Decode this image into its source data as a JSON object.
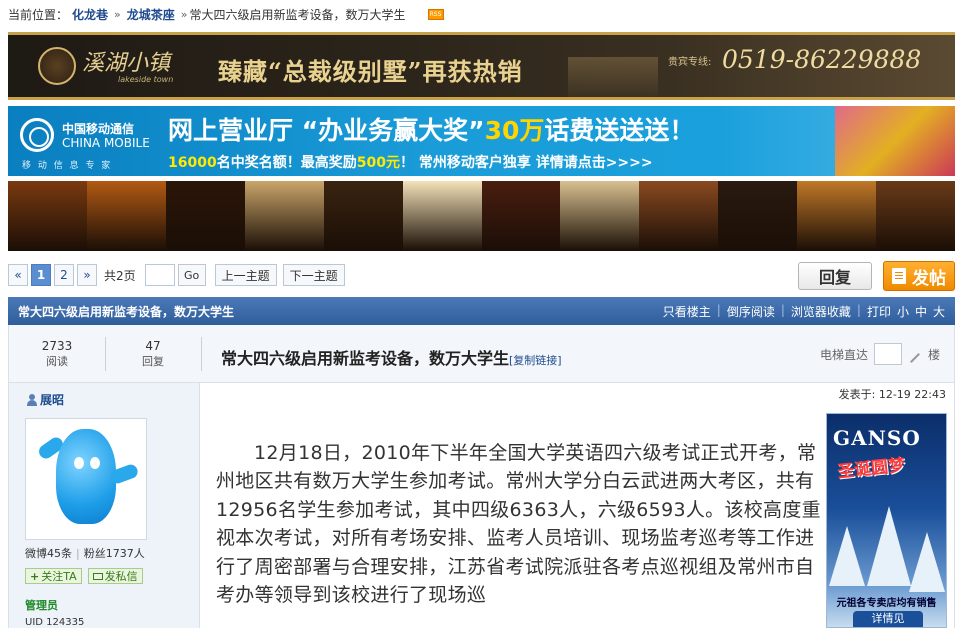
{
  "breadcrumb": {
    "label": "当前位置：",
    "items": [
      "化龙巷",
      "龙城茶座"
    ],
    "separators": [
      "»",
      "»"
    ],
    "current": "常大四六级启用新监考设备，数万大学生",
    "rss_label": "RSS"
  },
  "banners": {
    "realestate": {
      "brand": "溪湖小镇",
      "brand_sub": "lakeside town",
      "slogan": "臻藏“总裁级别墅”再获热销",
      "hotline_label": "贵宾专线:",
      "hotline": "0519-86229888"
    },
    "mobile": {
      "logo_cn": "中国移动通信",
      "logo_en": "CHINA MOBILE",
      "logo_sub": "移 动 信 息 专 家",
      "headline_pre": "网上营业厅 “办业务赢大奖”",
      "headline_em": "30万",
      "headline_post": "话费送送送！",
      "sub_a": "16000",
      "sub_b": "名中奖名额！最高奖励",
      "sub_c": "500元",
      "sub_d": "！ 常州移动客户独享  详情请点击>>>>"
    },
    "wine_strip_colors": [
      "#7a3a10",
      "#b25a14",
      "#2b1608",
      "#c9a56a",
      "#3a2410",
      "#f3e2b8",
      "#4a1e10",
      "#d8c090",
      "#8a4a20",
      "#2a1a10",
      "#c07828",
      "#6a3a18"
    ]
  },
  "pager": {
    "prev": "«",
    "pages": [
      "1",
      "2"
    ],
    "next": "»",
    "total": "共2页",
    "go": "Go",
    "prev_topic": "上一主题",
    "next_topic": "下一主题"
  },
  "actions": {
    "reply": "回复",
    "post": "发帖"
  },
  "thread_bar": {
    "title": "常大四六级启用新监考设备，数万大学生",
    "links": [
      "只看楼主",
      "倒序阅读",
      "浏览器收藏",
      "打印",
      "小",
      "中",
      "大"
    ]
  },
  "stats": {
    "views_num": "2733",
    "views_label": "阅读",
    "replies_num": "47",
    "replies_label": "回复"
  },
  "subject": {
    "title": "常大四六级启用新监考设备，数万大学生",
    "copy_link": "[复制链接]"
  },
  "jump": {
    "label": "电梯直达",
    "unit": "楼"
  },
  "author": {
    "name": "展昭",
    "weibo": "微博45条",
    "fans": "粉丝1737人",
    "follow": "关注TA",
    "message": "发私信",
    "role": "管理员",
    "uid": "UID 124335"
  },
  "post": {
    "time": "发表于: 12-19 22:43",
    "body": "12月18日，2010年下半年全国大学英语四六级考试正式开考，常州地区共有数万大学生参加考试。常州大学分白云武进两大考区，共有12956名学生参加考试，其中四级6363人，六级6593人。该校高度重视本次考试，对所有考场安排、监考人员培训、现场监考巡考等工作进行了周密部署与合理安排，江苏省考试院派驻各考点巡视组及常州市自考办等领导到该校进行了现场巡"
  },
  "side_ad": {
    "brand": "GANSO",
    "theme": "圣诞圆梦",
    "footer": "元祖各专卖店均有销售",
    "cta": "详情见"
  }
}
